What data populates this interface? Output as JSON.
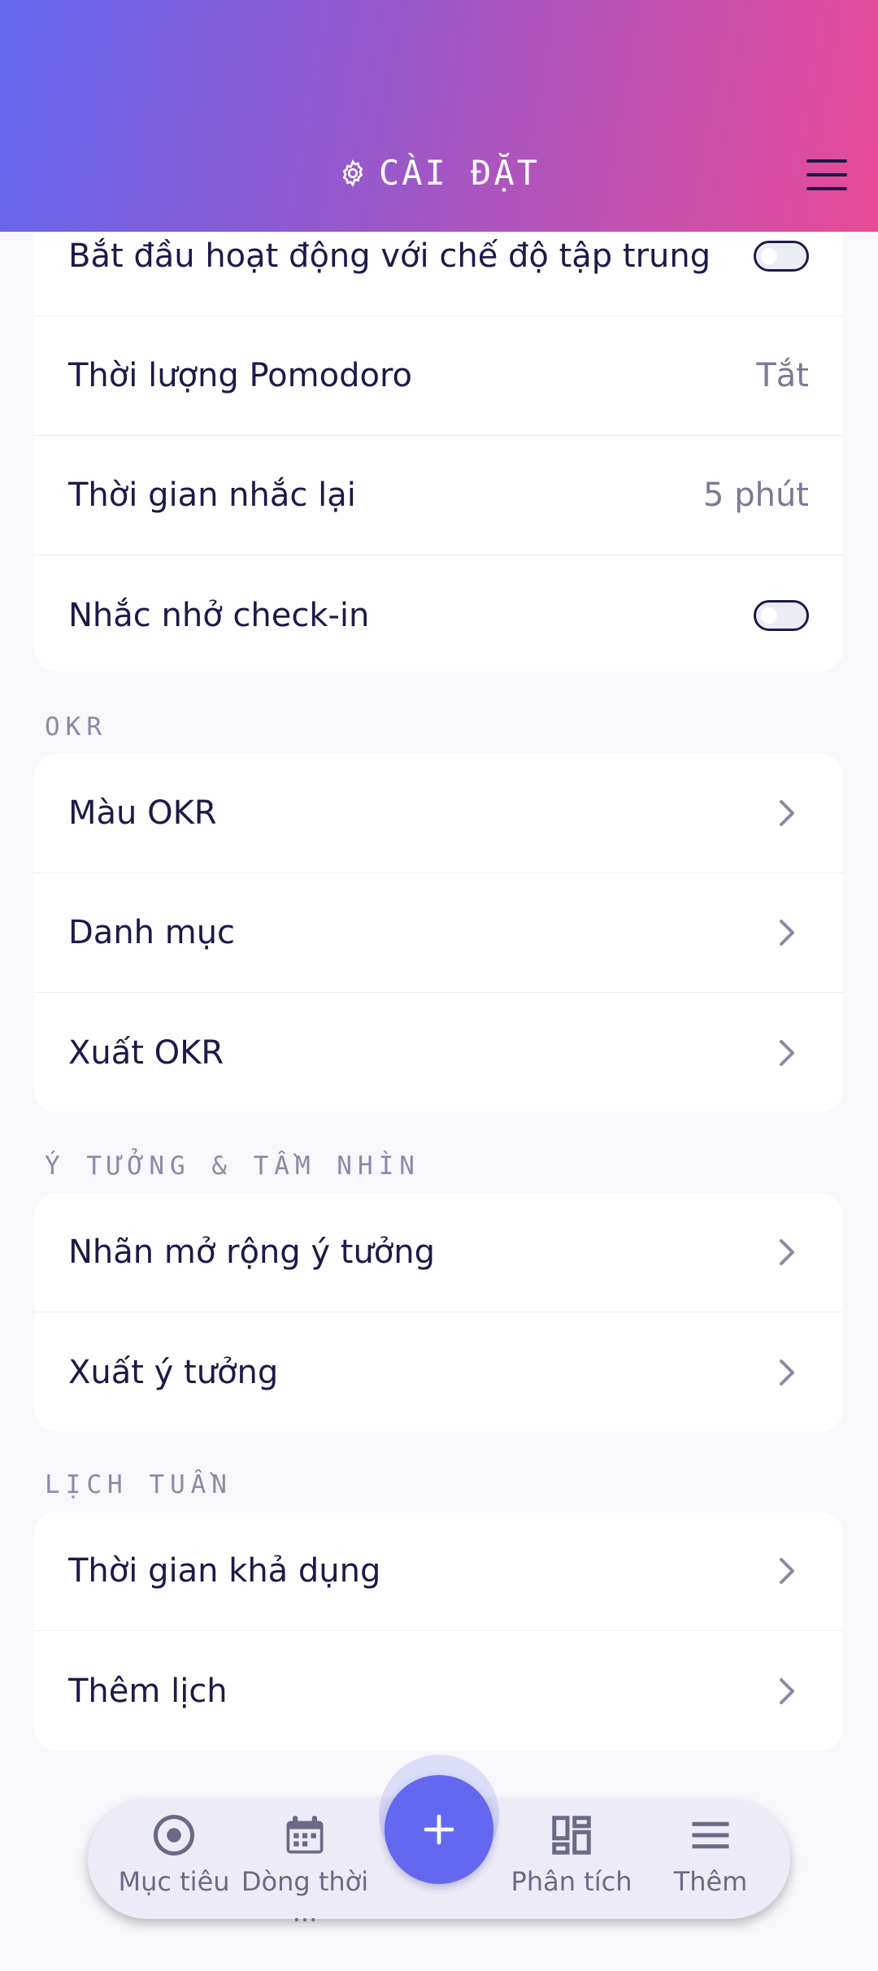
{
  "header": {
    "title": "CÀI ĐẶT"
  },
  "top_card": {
    "rows": [
      {
        "label": "Bắt đầu hoạt động với chế độ tập trung",
        "toggle": false
      },
      {
        "label": "Thời lượng Pomodoro",
        "value": "Tắt"
      },
      {
        "label": "Thời gian nhắc lại",
        "value": "5 phút"
      },
      {
        "label": "Nhắc nhở check-in",
        "toggle": false
      }
    ]
  },
  "sections": {
    "okr": {
      "title": "OKR",
      "items": [
        "Màu OKR",
        "Danh mục",
        "Xuất OKR"
      ]
    },
    "ideas": {
      "title": "Ý TƯỞNG & TẦM NHÌN",
      "items": [
        "Nhãn mở rộng ý tưởng",
        "Xuất ý tưởng"
      ]
    },
    "calendar": {
      "title": "LỊCH TUẦN",
      "items": [
        "Thời gian khả dụng",
        "Thêm lịch"
      ]
    }
  },
  "bottom_nav": {
    "items": [
      {
        "label": "Mục tiêu",
        "icon": "target-icon"
      },
      {
        "label": "Dòng thời ...",
        "icon": "calendar-icon"
      },
      {
        "label": "Phân tích",
        "icon": "dashboard-icon"
      },
      {
        "label": "Thêm",
        "icon": "menu-icon"
      }
    ],
    "fab_icon": "plus-icon"
  },
  "colors": {
    "gradient_start": "#6468f0",
    "gradient_end": "#e84a96",
    "accent": "#6468f0",
    "text_primary": "#1c1a47",
    "text_secondary": "#7a7a95"
  }
}
